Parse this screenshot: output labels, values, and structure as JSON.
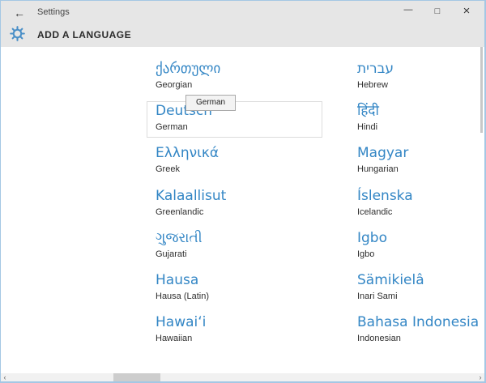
{
  "window": {
    "title": "Settings"
  },
  "icons": {
    "back": "←",
    "minimize": "—",
    "maximize": "□",
    "close": "×",
    "scroll_left": "‹",
    "scroll_right": "›"
  },
  "header": {
    "title": "ADD A LANGUAGE"
  },
  "tooltip": {
    "text": "German"
  },
  "languages": {
    "left": [
      {
        "native": "ქართული",
        "english": "Georgian"
      },
      {
        "native": "Deutsch",
        "english": "German",
        "highlighted": true
      },
      {
        "native": "Ελληνικά",
        "english": "Greek"
      },
      {
        "native": "Kalaallisut",
        "english": "Greenlandic"
      },
      {
        "native": "ગુજરાતી",
        "english": "Gujarati"
      },
      {
        "native": "Hausa",
        "english": "Hausa (Latin)"
      },
      {
        "native": "Hawaiʻi",
        "english": "Hawaiian"
      }
    ],
    "right": [
      {
        "native": "עברית",
        "english": "Hebrew"
      },
      {
        "native": "हिंदी",
        "english": "Hindi"
      },
      {
        "native": "Magyar",
        "english": "Hungarian"
      },
      {
        "native": "Íslenska",
        "english": "Icelandic"
      },
      {
        "native": "Igbo",
        "english": "Igbo"
      },
      {
        "native": "Sämikielâ",
        "english": "Inari Sami"
      },
      {
        "native": "Bahasa Indonesia",
        "english": "Indonesian"
      }
    ]
  },
  "colors": {
    "accent_text": "#3386c5",
    "gear_icon": "#4a8fc7",
    "window_border": "#a4c7e4",
    "band_background": "#e6e6e6"
  }
}
